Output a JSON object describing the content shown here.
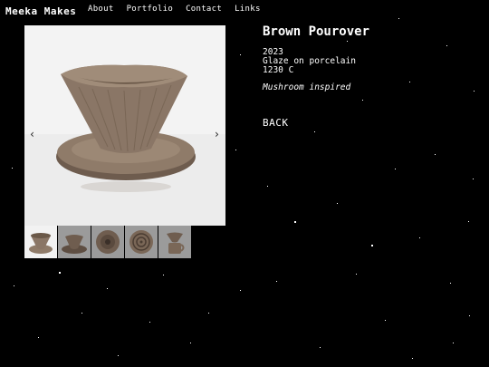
{
  "site": {
    "brand": "Meeka Makes"
  },
  "nav": {
    "items": [
      "About",
      "Portfolio",
      "Contact",
      "Links"
    ]
  },
  "gallery": {
    "prev_icon": "‹",
    "next_icon": "›",
    "thumbnail_count": 5,
    "active_index": 0
  },
  "artwork": {
    "title": "Brown Pourover",
    "year": "2023",
    "material": "Glaze on porcelain",
    "temperature": "1230 C",
    "description": "Mushroom inspired"
  },
  "actions": {
    "back_label": "BACK"
  },
  "colors": {
    "background": "#000000",
    "text": "#ffffff",
    "clay": "#8a7766",
    "photo_bg": "#f2f2f2"
  }
}
